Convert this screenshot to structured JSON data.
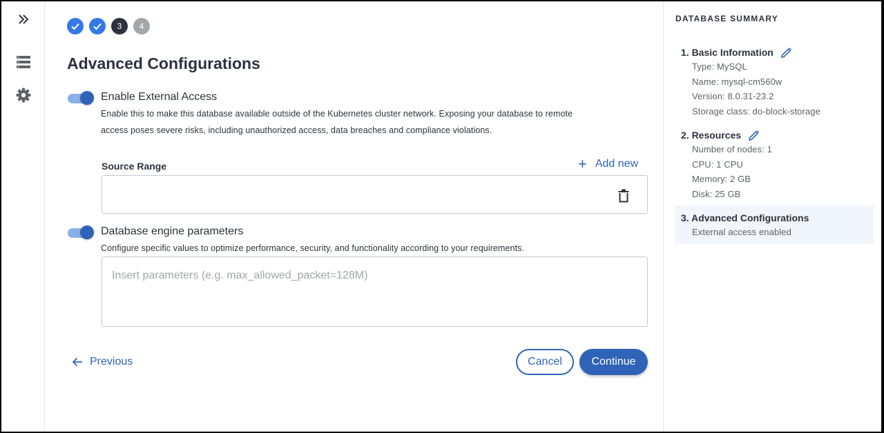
{
  "stepper": {
    "steps": [
      {
        "label": "",
        "state": "done",
        "icon": "check-icon"
      },
      {
        "label": "",
        "state": "done",
        "icon": "check-icon"
      },
      {
        "label": "3",
        "state": "current"
      },
      {
        "label": "4",
        "state": "pending"
      }
    ]
  },
  "main": {
    "title": "Advanced Configurations",
    "external_access": {
      "label": "Enable External Access",
      "enabled": true,
      "description_line1": "Enable this to make this database available outside of the Kubernetes cluster network. Exposing your database to remote",
      "description_line2": "access poses severe risks, including unauthorized access, data breaches and compliance violations."
    },
    "source_range": {
      "label": "Source Range",
      "add_new_label": "Add new",
      "value": ""
    },
    "engine_params": {
      "label": "Database engine parameters",
      "enabled": true,
      "description": "Configure specific values to optimize performance, security, and functionality according to your requirements.",
      "placeholder": "Insert parameters (e.g. max_allowed_packet=128M)",
      "value": ""
    },
    "buttons": {
      "previous": "Previous",
      "cancel": "Cancel",
      "continue": "Continue"
    }
  },
  "summary": {
    "title": "DATABASE SUMMARY",
    "sections": [
      {
        "heading": "1. Basic Information",
        "editable": true,
        "lines": [
          "Type: MySQL",
          "Name: mysql-cm560w",
          "Version: 8.0.31-23.2",
          "Storage class: do-block-storage"
        ]
      },
      {
        "heading": "2. Resources",
        "editable": true,
        "lines": [
          "Number of nodes: 1",
          "CPU: 1 CPU",
          "Memory: 2 GB",
          "Disk: 25 GB"
        ]
      },
      {
        "heading": "3. Advanced Configurations",
        "editable": false,
        "active": true,
        "lines": [
          "External access enabled"
        ]
      }
    ]
  },
  "colors": {
    "accent": "#2f63b8",
    "step_done": "#3478e5",
    "step_current": "#2c323e",
    "step_pending": "#a3a6ab",
    "text": "#2c323e",
    "muted": "#5d6168"
  }
}
